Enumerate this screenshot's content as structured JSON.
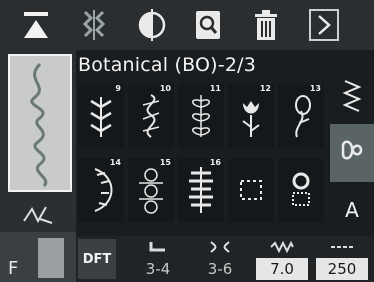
{
  "toolbar": {
    "buttons": [
      "home-icon",
      "pattern-icon",
      "mirror-icon",
      "zoom-icon",
      "trash-icon",
      "next-arrow-icon"
    ]
  },
  "title": "Botanical (BO)-2/3",
  "stitches": [
    {
      "number": "9"
    },
    {
      "number": "10"
    },
    {
      "number": "11"
    },
    {
      "number": "12"
    },
    {
      "number": "13"
    },
    {
      "number": "14"
    },
    {
      "number": "15"
    },
    {
      "number": "16"
    },
    {
      "number": ""
    },
    {
      "number": ""
    }
  ],
  "right_panel": {
    "letter_button": "A"
  },
  "bottom": {
    "dft_label": "DFT",
    "params": [
      {
        "value": "3-4"
      },
      {
        "value": "3-6"
      },
      {
        "value": "7.0"
      },
      {
        "value": "250"
      }
    ]
  },
  "left_panel": {
    "f_label": "F"
  }
}
